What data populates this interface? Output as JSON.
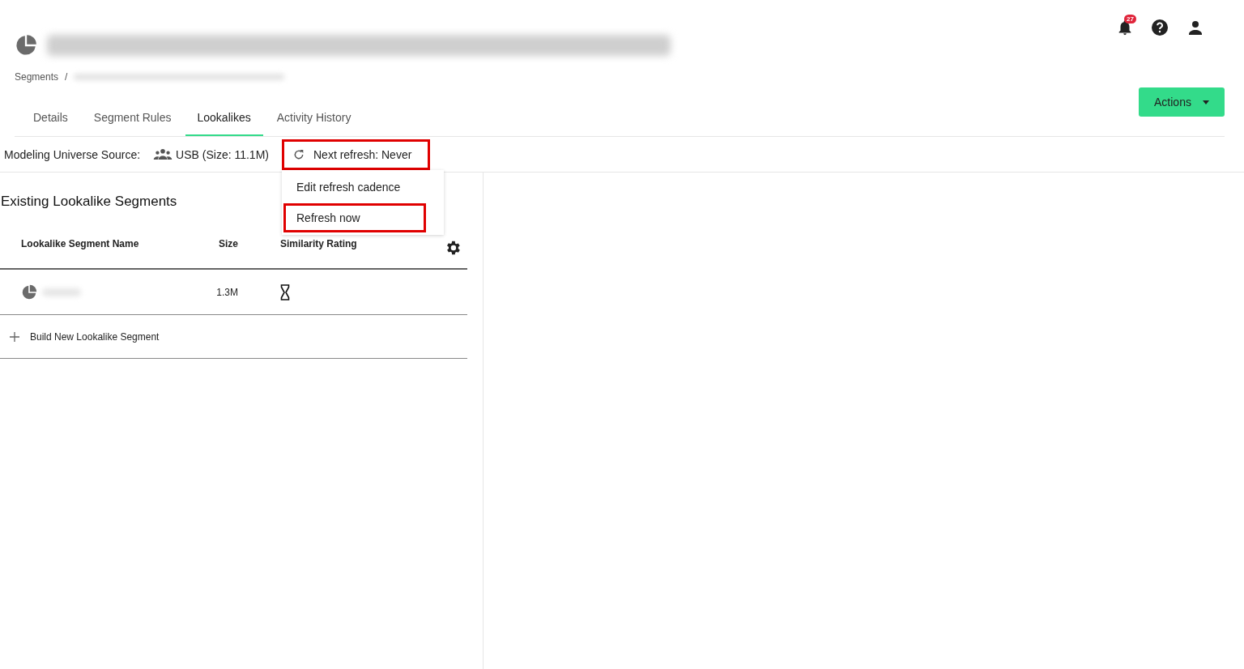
{
  "header": {
    "notification_count": "27"
  },
  "actions_button": {
    "label": "Actions"
  },
  "breadcrumb": {
    "root": "Segments",
    "separator": "/"
  },
  "tabs": [
    {
      "label": "Details",
      "selected": false
    },
    {
      "label": "Segment Rules",
      "selected": false
    },
    {
      "label": "Lookalikes",
      "selected": true
    },
    {
      "label": "Activity History",
      "selected": false
    }
  ],
  "source": {
    "label": "Modeling Universe Source:",
    "value": "USB (Size: 11.1M)"
  },
  "refresh": {
    "label": "Next refresh: Never",
    "highlighted": true,
    "menu": [
      {
        "label": "Edit refresh cadence",
        "highlighted": false
      },
      {
        "label": "Refresh now",
        "highlighted": true
      }
    ]
  },
  "section_title": "Existing Lookalike Segments",
  "table": {
    "columns": [
      "Lookalike Segment Name",
      "Size",
      "Similarity Rating"
    ],
    "rows": [
      {
        "size": "1.3M",
        "pending": true
      }
    ]
  },
  "build_new": {
    "label": "Build New Lookalike Segment"
  }
}
